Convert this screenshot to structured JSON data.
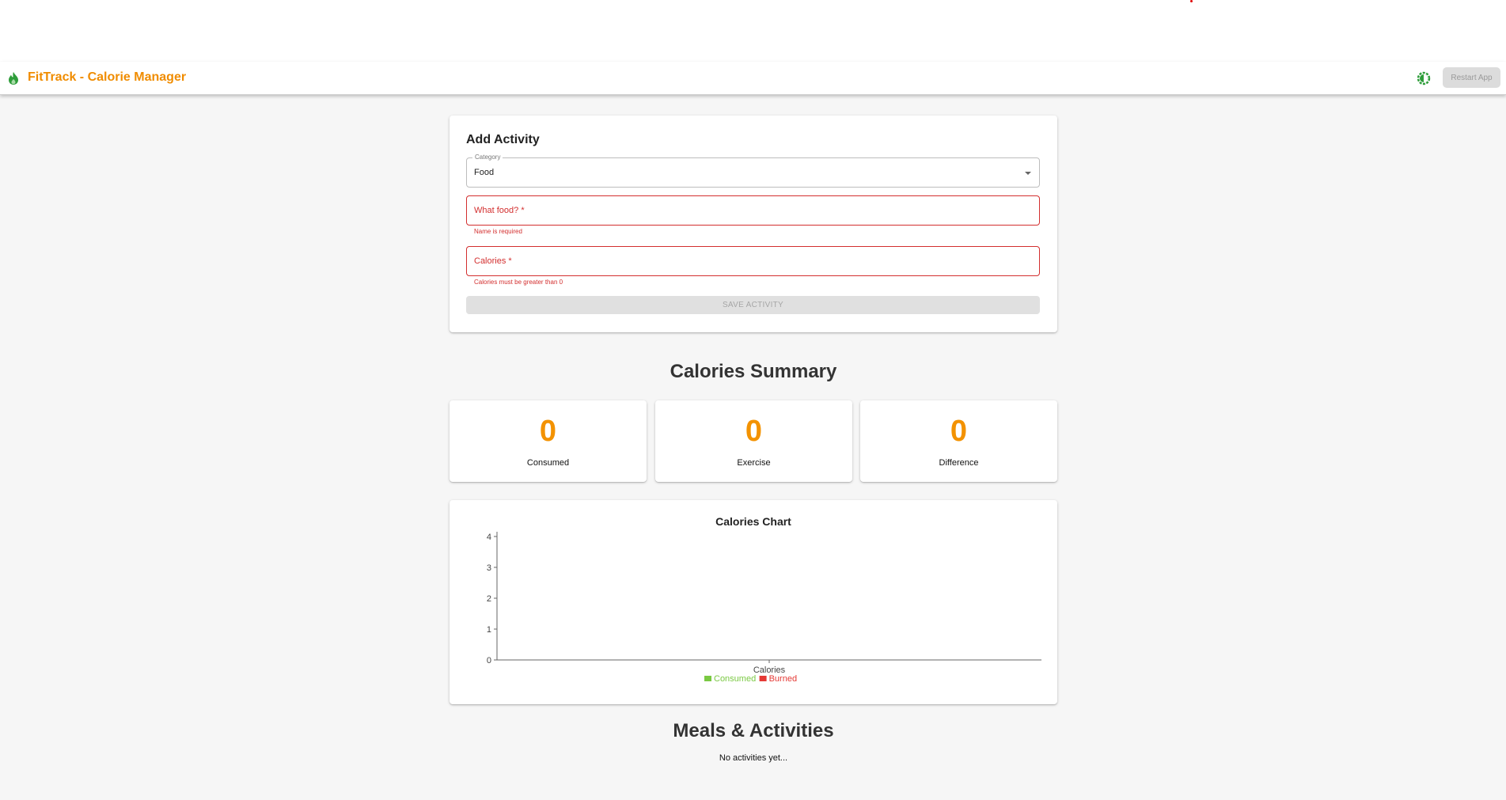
{
  "app": {
    "title": "FitTrack - Calorie Manager",
    "restart_label": "Restart App",
    "brand_color": "#f08c00",
    "icons": {
      "brand": "flame-icon",
      "theme": "theme-toggle-icon"
    }
  },
  "form": {
    "title": "Add Activity",
    "category": {
      "label": "Category",
      "value": "Food"
    },
    "name_field": {
      "placeholder": "What food? *",
      "error": "Name is required"
    },
    "calories_field": {
      "placeholder": "Calories *",
      "error": "Calories must be greater than 0"
    },
    "save_label": "SAVE ACTIVITY"
  },
  "summary": {
    "heading": "Calories Summary",
    "cards": [
      {
        "value": "0",
        "label": "Consumed"
      },
      {
        "value": "0",
        "label": "Exercise"
      },
      {
        "value": "0",
        "label": "Difference"
      }
    ],
    "accent": "#f39200"
  },
  "chart_data": {
    "type": "bar",
    "title": "Calories Chart",
    "categories": [
      "Calories"
    ],
    "series": [
      {
        "name": "Consumed",
        "values": [
          0
        ],
        "color": "#7ac943"
      },
      {
        "name": "Burned",
        "values": [
          0
        ],
        "color": "#e53935"
      }
    ],
    "ylim": [
      0,
      4
    ],
    "yticks": [
      "0",
      "1",
      "2",
      "3",
      "4"
    ],
    "legend": "bottom"
  },
  "activities": {
    "heading": "Meals & Activities",
    "empty_text": "No activities yet..."
  }
}
